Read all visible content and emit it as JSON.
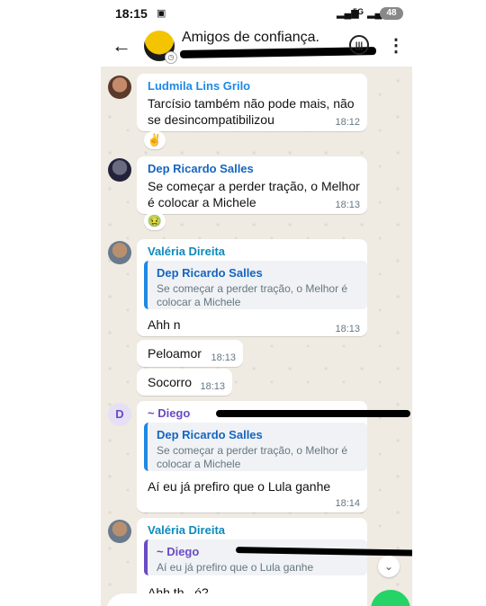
{
  "status": {
    "time": "18:15",
    "battery": "48",
    "net": "5G"
  },
  "header": {
    "title": "Amigos de confiança."
  },
  "messages": [
    {
      "sender": "Ludmila Lins Grilo",
      "text": "Tarcísio também não pode mais, não se desincompatibilizou",
      "time": "18:12",
      "reaction": "✌"
    },
    {
      "sender": "Dep Ricardo Salles",
      "text": "Se começar a perder tração, o Melhor é colocar a Michele",
      "time": "18:13",
      "reaction": "🤢"
    },
    {
      "sender": "Valéria Direita",
      "quote_sender": "Dep Ricardo Salles",
      "quote_text": "Se começar a perder tração, o Melhor é colocar a Michele",
      "text": "Ahh n",
      "time": "18:13"
    },
    {
      "text": "Peloamor",
      "time": "18:13"
    },
    {
      "text": "Socorro",
      "time": "18:13"
    },
    {
      "sender": "~ Diego",
      "avatar_letter": "D",
      "quote_sender": "Dep Ricardo Salles",
      "quote_text": "Se começar a perder tração, o Melhor é colocar a Michele",
      "text": "Aí eu já prefiro que o Lula ganhe",
      "time": "18:14"
    },
    {
      "sender": "Valéria Direita",
      "quote_sender": "~ Diego",
      "quote_text": "Aí eu já prefiro que o Lula ganhe",
      "text": "Ahh th...ó?"
    }
  ],
  "colors": {
    "ludmila": "#1e88e5",
    "salles": "#1565c0",
    "valeria": "#0d8abc",
    "diego": "#6a4bc4",
    "fab": "#25d366"
  }
}
